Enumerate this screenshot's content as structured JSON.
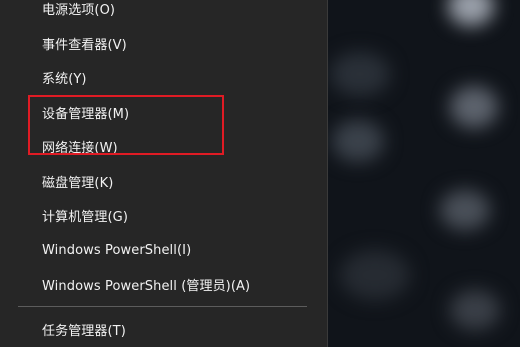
{
  "menu": {
    "items": [
      {
        "label": "电源选项(O)"
      },
      {
        "label": "事件查看器(V)"
      },
      {
        "label": "系统(Y)"
      },
      {
        "label": "设备管理器(M)"
      },
      {
        "label": "网络连接(W)"
      },
      {
        "label": "磁盘管理(K)"
      },
      {
        "label": "计算机管理(G)"
      },
      {
        "label": "Windows PowerShell(I)"
      },
      {
        "label": "Windows PowerShell (管理员)(A)"
      },
      {
        "label": "任务管理器(T)"
      }
    ]
  },
  "colors": {
    "menu_bg": "#262626",
    "text": "#f2f2f2",
    "separator": "#5c5c5c",
    "annotation_box": "#e01b24"
  }
}
